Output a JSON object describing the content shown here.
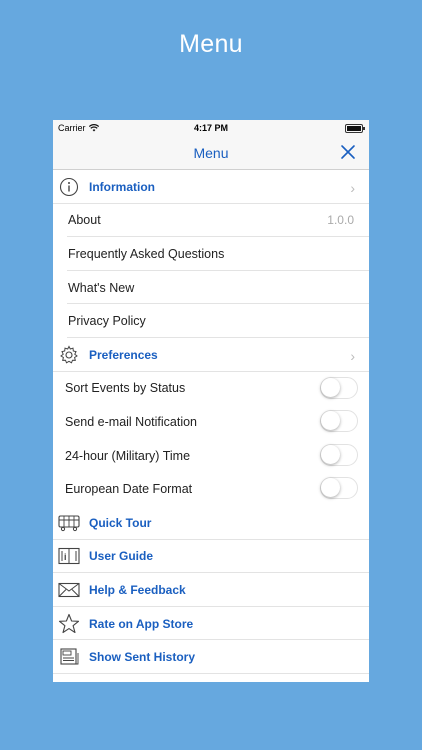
{
  "promo": {
    "title": "Menu"
  },
  "status_bar": {
    "carrier": "Carrier",
    "time": "4:17 PM"
  },
  "navbar": {
    "title": "Menu"
  },
  "sections": {
    "information": {
      "label": "Information",
      "icon": "info-icon"
    },
    "about": {
      "label": "About",
      "value": "1.0.0"
    },
    "faq": {
      "label": "Frequently Asked Questions"
    },
    "whats_new": {
      "label": "What's New"
    },
    "privacy": {
      "label": "Privacy Policy"
    },
    "preferences": {
      "label": "Preferences",
      "icon": "gear-icon"
    },
    "sort_events": {
      "label": "Sort Events by Status",
      "on": false
    },
    "send_email": {
      "label": "Send e-mail Notification",
      "on": false
    },
    "military_time": {
      "label": "24-hour (Military) Time",
      "on": false
    },
    "european_date": {
      "label": "European Date Format",
      "on": false
    },
    "quick_tour": {
      "label": "Quick Tour",
      "icon": "bus-icon"
    },
    "user_guide": {
      "label": "User Guide",
      "icon": "book-icon"
    },
    "help_feedback": {
      "label": "Help & Feedback",
      "icon": "envelope-icon"
    },
    "rate": {
      "label": "Rate on App Store",
      "icon": "star-icon"
    },
    "sent_history": {
      "label": "Show Sent History",
      "icon": "history-icon"
    }
  },
  "colors": {
    "background": "#66a8df",
    "accent": "#1a5fc0"
  }
}
